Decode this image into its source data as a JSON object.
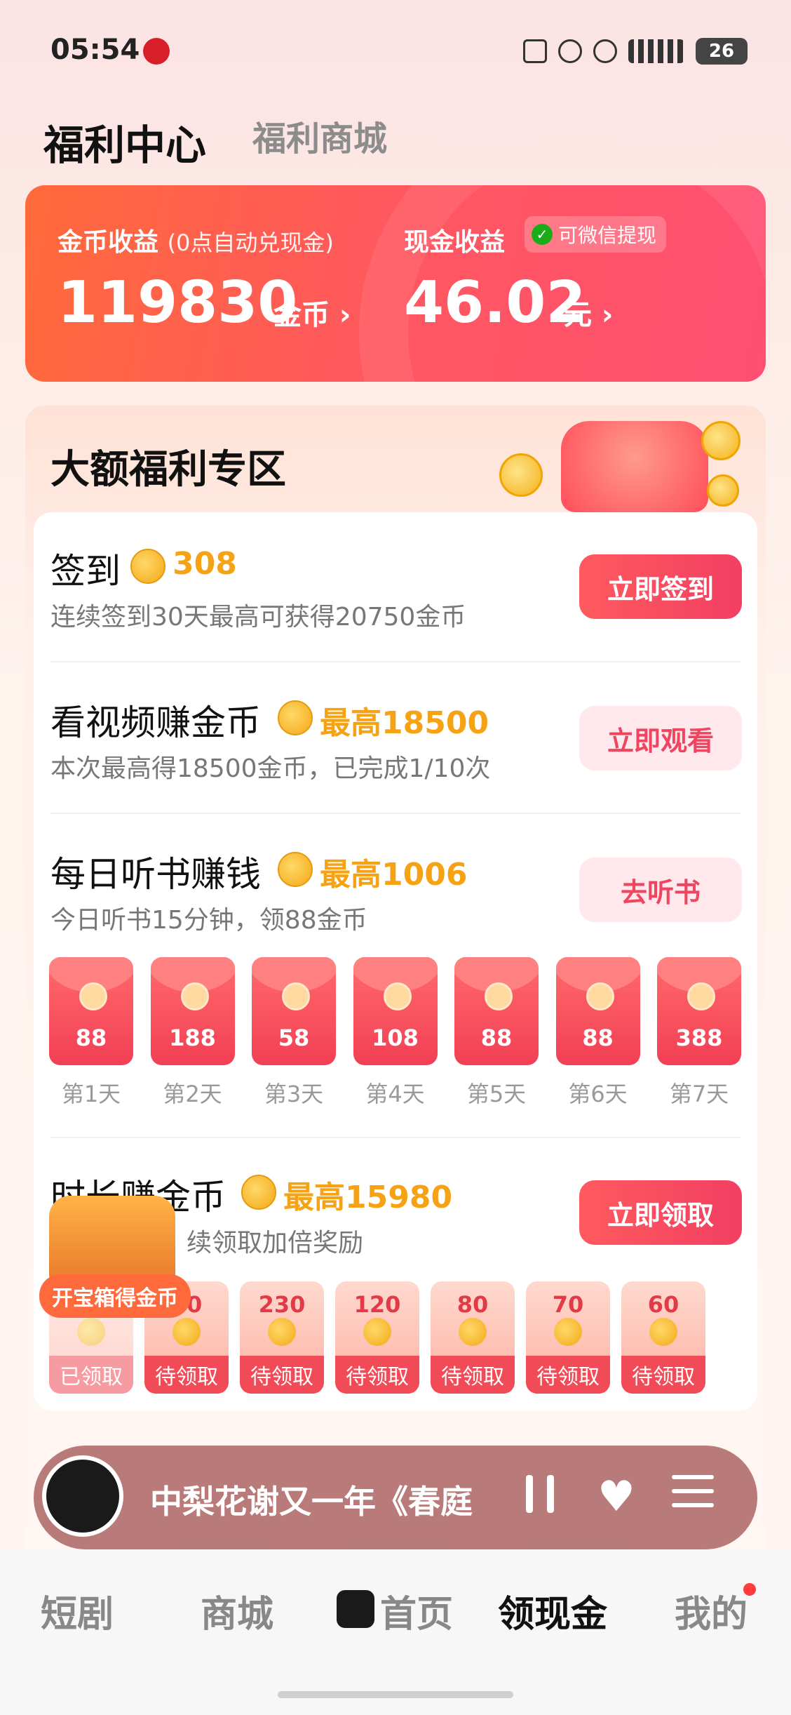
{
  "status_bar": {
    "time": "05:54",
    "battery": "26"
  },
  "header": {
    "tab_active": "福利中心",
    "tab_other": "福利商城"
  },
  "earnings": {
    "coin_label": "金币收益",
    "coin_note": "(0点自动兑现金)",
    "coin_value": "119830",
    "coin_unit": "金币 ›",
    "cash_label": "现金收益",
    "wechat_badge": "可微信提现",
    "cash_value": "46.02",
    "cash_unit": "元 ›"
  },
  "section": {
    "title": "大额福利专区"
  },
  "tasks": {
    "checkin": {
      "title": "签到",
      "reward": "308",
      "sub": "连续签到30天最高可获得20750金币",
      "button": "立即签到"
    },
    "video": {
      "title": "看视频赚金币",
      "reward": "最高18500",
      "sub": "本次最高得18500金币，已完成1/10次",
      "button": "立即观看"
    },
    "listen": {
      "title": "每日听书赚钱",
      "reward": "最高1006",
      "sub": "今日听书15分钟，领88金币",
      "button": "去听书"
    },
    "duration": {
      "title": "时长赚金币",
      "reward": "最高15980",
      "sub": "续领取加倍奖励",
      "button": "立即领取"
    }
  },
  "envelopes": [
    {
      "value": "88",
      "day": "第1天"
    },
    {
      "value": "188",
      "day": "第2天"
    },
    {
      "value": "58",
      "day": "第3天"
    },
    {
      "value": "108",
      "day": "第4天"
    },
    {
      "value": "88",
      "day": "第5天"
    },
    {
      "value": "88",
      "day": "第6天"
    },
    {
      "value": "388",
      "day": "第7天"
    }
  ],
  "time_cards": [
    {
      "value": "",
      "status": "已领取"
    },
    {
      "value": "40",
      "status": "待领取"
    },
    {
      "value": "230",
      "status": "待领取"
    },
    {
      "value": "120",
      "status": "待领取"
    },
    {
      "value": "80",
      "status": "待领取"
    },
    {
      "value": "70",
      "status": "待领取"
    },
    {
      "value": "60",
      "status": "待领取"
    }
  ],
  "chest": {
    "label": "开宝箱得金币"
  },
  "player": {
    "title": "中梨花谢又一年《春庭"
  },
  "bottom_nav": {
    "item1": "短剧",
    "item2": "商城",
    "item3": "首页",
    "item4": "领现金",
    "item5": "我的"
  }
}
